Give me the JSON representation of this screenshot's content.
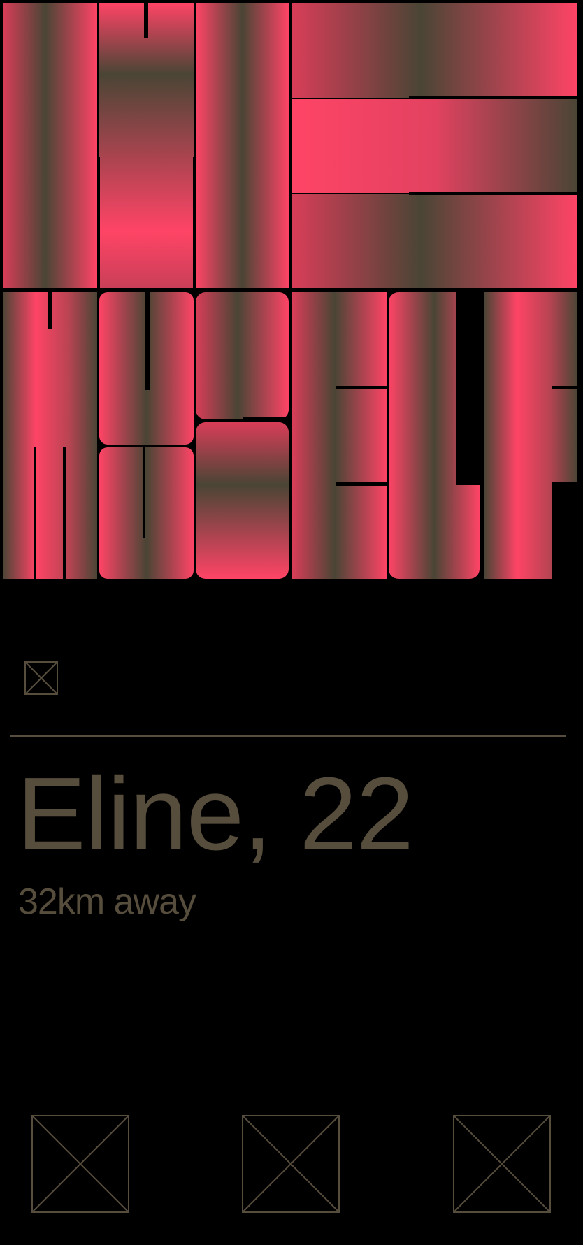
{
  "profile": {
    "name_age": "Eline, 22",
    "distance": "32km away"
  },
  "icons": {
    "top": "placeholder-image-icon",
    "actions": [
      "placeholder-image-icon",
      "placeholder-image-icon",
      "placeholder-image-icon"
    ]
  },
  "colors": {
    "background": "#000000",
    "text": "#564d3c",
    "photo_pink": "#ff4466",
    "photo_olive": "#4a4535"
  }
}
